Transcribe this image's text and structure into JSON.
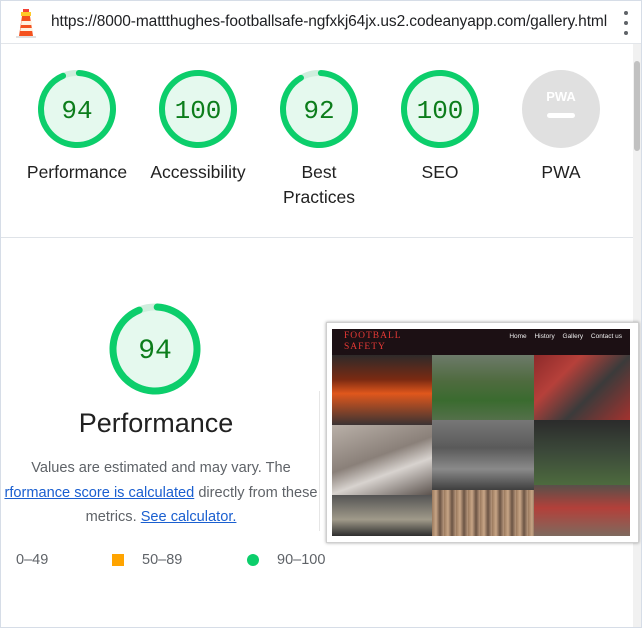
{
  "browser": {
    "url": "https://8000-mattthughes-footballsafe-ngfxkj64jx.us2.codeanyapp.com/gallery.html",
    "logo_icon": "lighthouse-icon",
    "menu_icon": "more-vert-icon"
  },
  "categories": [
    {
      "score": "94",
      "label": "Performance",
      "value": 94
    },
    {
      "score": "100",
      "label": "Accessibility",
      "value": 100
    },
    {
      "score": "92",
      "label": "Best Practices",
      "value": 92
    },
    {
      "score": "100",
      "label": "SEO",
      "value": 100
    },
    {
      "score": "PWA",
      "label": "PWA"
    }
  ],
  "performance": {
    "score": "94",
    "value": 94,
    "title": "Performance",
    "desc_line1": "Values are estimated and may vary. The",
    "desc_link1": "rformance score is calculated",
    "desc_mid": " directly from these",
    "desc_line3": "metrics. ",
    "desc_link2": "See calculator."
  },
  "legend": [
    {
      "range": "0–49",
      "shape": "triangle",
      "color": "#ff4e42"
    },
    {
      "range": "50–89",
      "shape": "square",
      "color": "#ffa400"
    },
    {
      "range": "90–100",
      "shape": "circle",
      "color": "#0cce6b"
    }
  ],
  "screenshot": {
    "brand_line1": "FOOTBALL",
    "brand_line2": "SAFETY",
    "nav": [
      "Home",
      "History",
      "Gallery",
      "Contact us"
    ]
  },
  "colors": {
    "pass_ring": "#0cce6b",
    "pass_fill": "#e5f9ee",
    "pass_text": "#0c7d1b",
    "pwa_gray": "#e0e0e0"
  }
}
